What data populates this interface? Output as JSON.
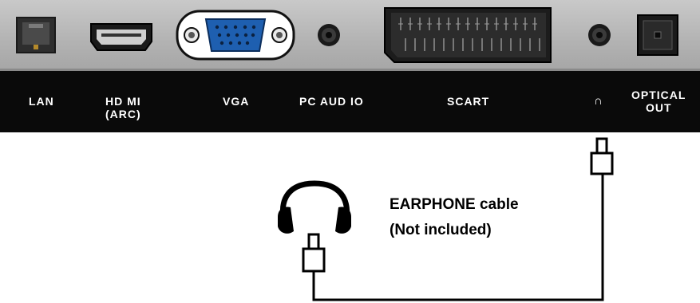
{
  "ports": [
    {
      "id": "lan",
      "label": "LAN"
    },
    {
      "id": "hdmi",
      "label": "HD MI\n(ARC)"
    },
    {
      "id": "vga",
      "label": "VGA"
    },
    {
      "id": "pc-audio",
      "label": "PC AUD IO"
    },
    {
      "id": "scart",
      "label": "SCART"
    },
    {
      "id": "headphone",
      "label": "∩"
    },
    {
      "id": "optical",
      "label": "OPTICAL\nOUT"
    }
  ],
  "caption": {
    "line1": "EARPHONE cable",
    "line2": "(Not included)"
  },
  "colors": {
    "panel": "#b8b8b8",
    "label_bar": "#0a0a0a",
    "vga_connector": "#1e5fb0",
    "lan_port": "#3a3a3a"
  },
  "icons": [
    "headphone-icon",
    "earphone-plug-icon",
    "cable-line"
  ]
}
